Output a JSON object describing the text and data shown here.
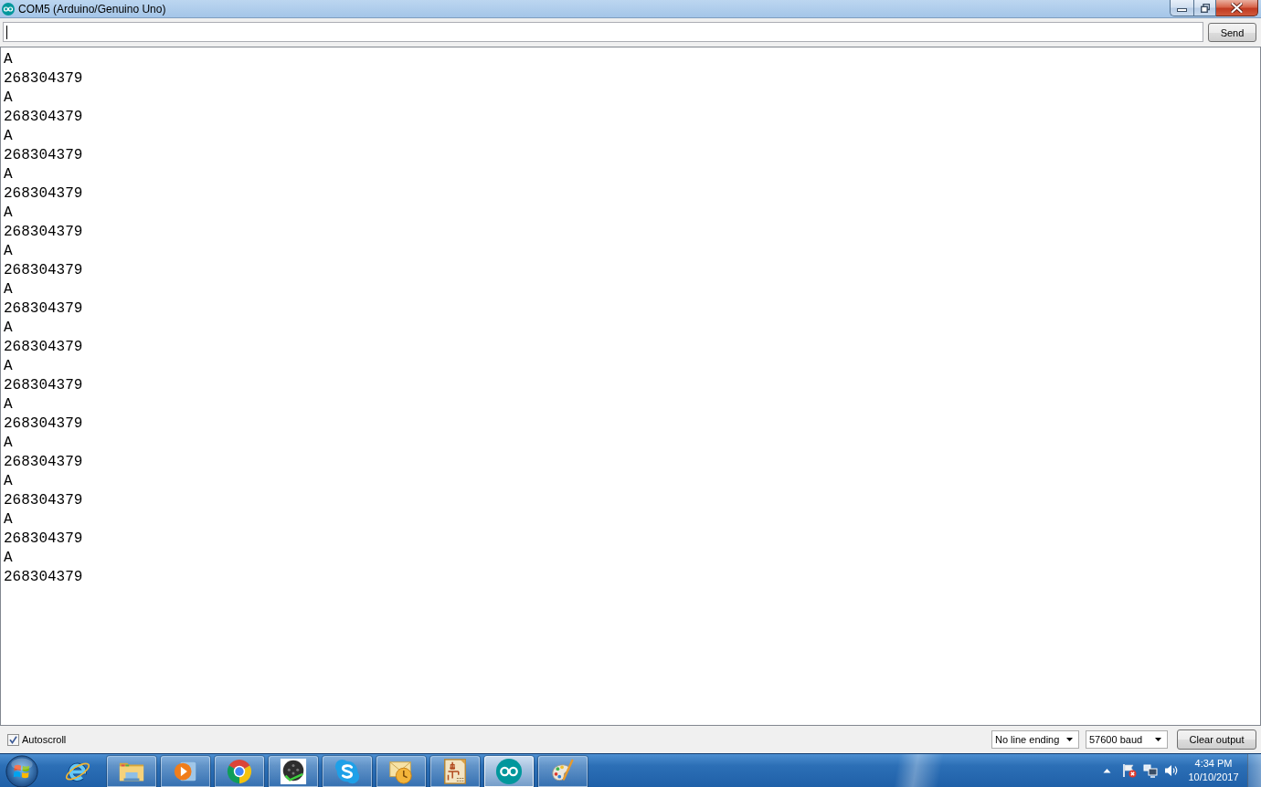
{
  "window": {
    "title": "COM5 (Arduino/Genuino Uno)"
  },
  "message_input": {
    "focused": true
  },
  "send_button": "Send",
  "output": {
    "lines": [
      "A",
      "268304379",
      "A",
      "268304379",
      "A",
      "268304379",
      "A",
      "268304379",
      "A",
      "268304379",
      "A",
      "268304379",
      "A",
      "268304379",
      "A",
      "268304379",
      "A",
      "268304379",
      "A",
      "268304379",
      "A",
      "268304379",
      "A",
      "268304379",
      "A",
      "268304379",
      "A",
      "268304379"
    ]
  },
  "autoscroll": {
    "label": "Autoscroll",
    "checked": true
  },
  "line_ending": {
    "value": "No line ending"
  },
  "baud_rate": {
    "value": "57600 baud"
  },
  "clear_button": "Clear output",
  "taskbar": {
    "apps": [
      {
        "kind": "ering",
        "running": false,
        "selected": false
      },
      {
        "kind": "folder",
        "running": true,
        "selected": false
      },
      {
        "kind": "play",
        "running": true,
        "selected": false
      },
      {
        "kind": "wheel",
        "running": true,
        "selected": false
      },
      {
        "kind": "disc",
        "running": true,
        "selected": false
      },
      {
        "kind": "sbubble",
        "running": true,
        "selected": false
      },
      {
        "kind": "envelope",
        "running": true,
        "selected": false
      },
      {
        "kind": "schematic",
        "running": true,
        "selected": false
      },
      {
        "kind": "infinity",
        "running": true,
        "selected": true
      },
      {
        "kind": "palette",
        "running": true,
        "selected": false
      }
    ],
    "clock": {
      "time": "4:34 PM",
      "date": "10/10/2017"
    }
  }
}
